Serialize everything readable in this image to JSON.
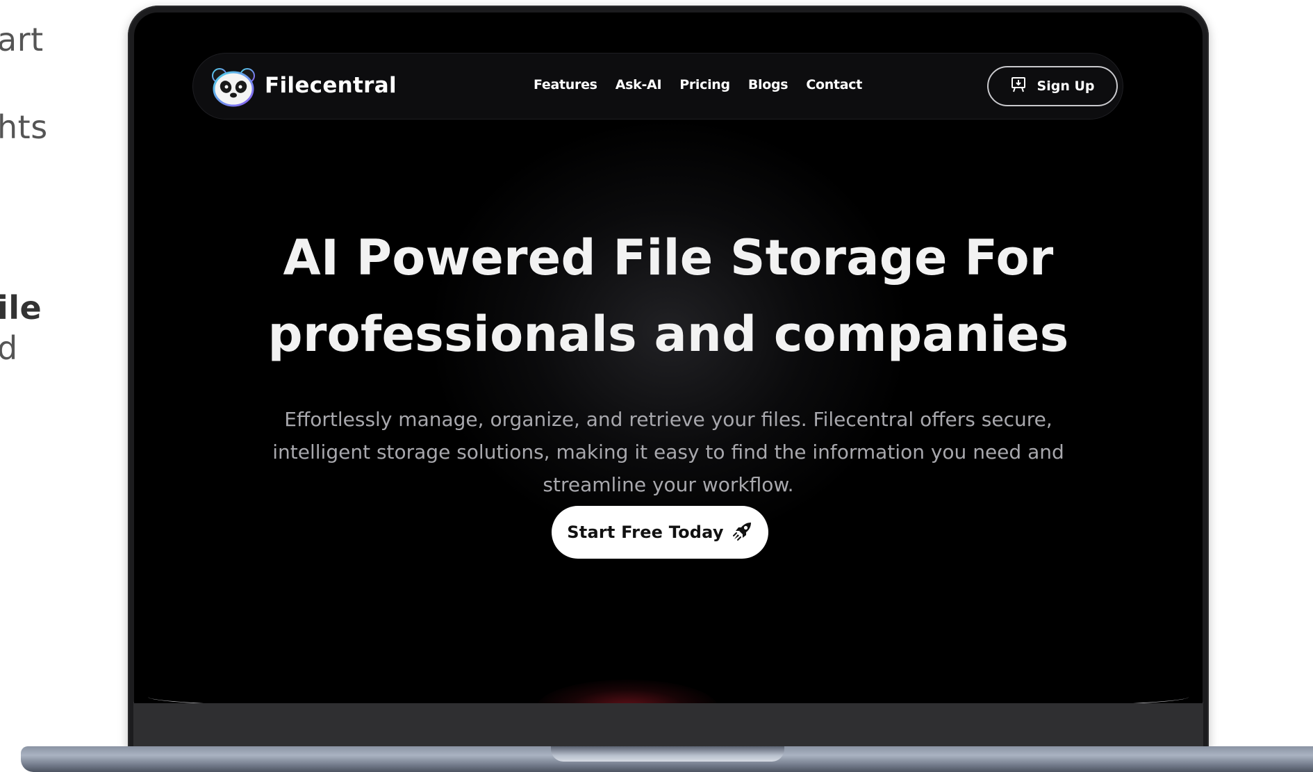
{
  "background_text": {
    "line1": "art",
    "line2": "hts",
    "line3": "ile",
    "line4": "d"
  },
  "navbar": {
    "brand_name": "Filecentral",
    "logo_icon": "panda-logo-icon",
    "links": [
      {
        "label": "Features"
      },
      {
        "label": "Ask-AI"
      },
      {
        "label": "Pricing"
      },
      {
        "label": "Blogs"
      },
      {
        "label": "Contact"
      }
    ],
    "signup": {
      "label": "Sign Up",
      "icon": "signup-icon"
    }
  },
  "hero": {
    "title_line1": "AI Powered File Storage For",
    "title_line2": "professionals and companies",
    "subtitle": "Effortlessly manage, organize, and retrieve your files. Filecentral offers secure, intelligent storage solutions, making it easy to find the information you need and streamline your workflow.",
    "cta": {
      "label": "Start Free Today",
      "icon": "rocket-icon"
    }
  },
  "colors": {
    "screen_bg": "#000000",
    "title": "#f2f2f2",
    "subtitle": "#a8a8ad",
    "cta_bg": "#ffffff",
    "cta_text": "#111111"
  }
}
